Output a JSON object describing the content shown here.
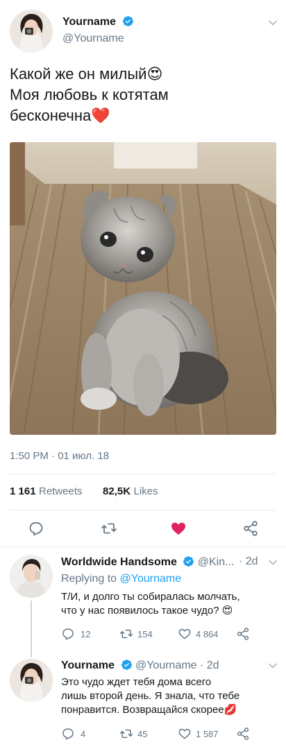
{
  "tweet": {
    "name": "Yourname",
    "handle": "@Yourname",
    "text_line1": "Какой же он милый",
    "text_line2": "Моя любовь к котятам",
    "text_line3": "бесконечна",
    "emoji1": "😍",
    "emoji2": "❤️",
    "timestamp": "1:50 PM · 01 июл. 18",
    "retweets_count": "1 161",
    "retweets_label": "Retweets",
    "likes_count": "82,5K",
    "likes_label": "Likes"
  },
  "reply1": {
    "name": "Worldwide Handsome",
    "handle": "@Kin...",
    "time": "· 2d",
    "replying_prefix": "Replying to",
    "replying_handle": "@Yourname",
    "text_line1": "Т/И, и долго ты собиралась молчать,",
    "text_line2": "что у нас появилось такое чудо?",
    "emoji": "😍",
    "replies": "12",
    "retweets": "154",
    "likes": "4 864"
  },
  "reply2": {
    "name": "Yourname",
    "handle": "@Yourname · 2d",
    "text_line1": "Это чудо ждет тебя дома всего",
    "text_line2": "лишь второй день. Я знала, что тебе",
    "text_line3": "понравится. Возвращайся скорее",
    "emoji": "💋",
    "replies": "4",
    "retweets": "45",
    "likes": "1 587"
  },
  "colors": {
    "accent": "#1da1f2",
    "like_red": "#e0245e",
    "muted": "#657786"
  }
}
